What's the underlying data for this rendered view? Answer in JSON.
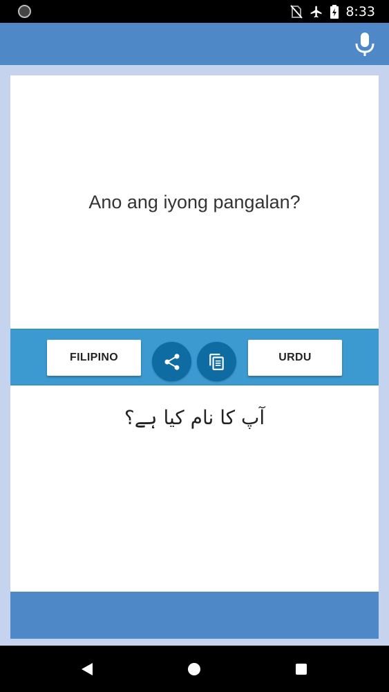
{
  "status_bar": {
    "time": "8:33",
    "icons": [
      "camera-dot-icon",
      "no-sim-icon",
      "airplane-mode-icon",
      "battery-charging-icon"
    ]
  },
  "app_bar": {
    "mic_icon": "microphone-icon"
  },
  "source": {
    "text": "Ano ang iyong pangalan?"
  },
  "controls": {
    "source_language": "FILIPINO",
    "target_language": "URDU",
    "share_icon": "share-icon",
    "copy_icon": "copy-icon"
  },
  "target": {
    "text": "آپ کا نام کیا ہے؟"
  },
  "nav": {
    "icons": [
      "back-icon",
      "home-icon",
      "recents-icon"
    ]
  },
  "colors": {
    "app_bar": "#4f88c6",
    "background": "#c5d3ef",
    "strip": "#3d9ad1",
    "circle_button": "#0f6ca3"
  }
}
